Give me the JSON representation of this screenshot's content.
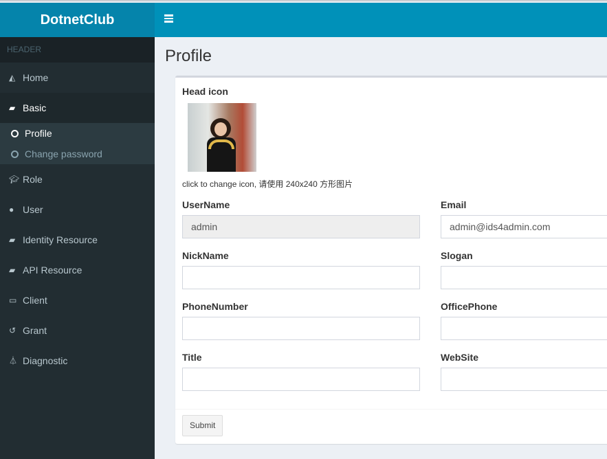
{
  "app": {
    "logo": "DotnetClub"
  },
  "sidebar": {
    "header": "HEADER",
    "items": [
      {
        "label": "Home",
        "icon": "area-chart-icon"
      },
      {
        "label": "Basic",
        "icon": "book-icon"
      },
      {
        "label": "Role",
        "icon": "graduation-cap-icon"
      },
      {
        "label": "User",
        "icon": "user-icon"
      },
      {
        "label": "Identity Resource",
        "icon": "book-icon"
      },
      {
        "label": "API Resource",
        "icon": "book-icon"
      },
      {
        "label": "Client",
        "icon": "desktop-icon"
      },
      {
        "label": "Grant",
        "icon": "history-icon"
      },
      {
        "label": "Diagnostic",
        "icon": "flask-icon"
      }
    ],
    "sub": [
      {
        "label": "Profile"
      },
      {
        "label": "Change password"
      }
    ]
  },
  "page": {
    "title": "Profile"
  },
  "form": {
    "head_icon_label": "Head icon",
    "hint": "click to change icon, 请使用 240x240 方形图片",
    "username_label": "UserName",
    "username_value": "admin",
    "email_label": "Email",
    "email_value": "admin@ids4admin.com",
    "nickname_label": "NickName",
    "slogan_label": "Slogan",
    "phone_label": "PhoneNumber",
    "officephone_label": "OfficePhone",
    "title_label": "Title",
    "website_label": "WebSite",
    "submit": "Submit"
  }
}
